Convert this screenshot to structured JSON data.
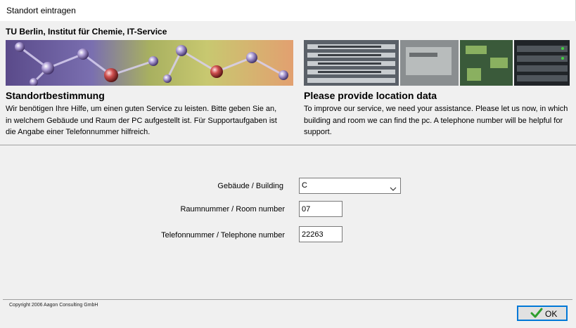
{
  "window": {
    "title": "Standort eintragen"
  },
  "header": {
    "org_title": "TU Berlin, Institut für Chemie, IT-Service",
    "left": {
      "heading": "Standortbestimmung",
      "text": "Wir benötigen Ihre Hilfe, um einen guten Service zu leisten. Bitte geben Sie an, in welchem Gebäude und Raum der PC aufgestellt ist. Für Supportaufgaben ist die Angabe einer Telefonnummer hilfreich."
    },
    "right": {
      "heading": "Please provide location data",
      "text": "To improve our service, we need your assistance. Please let us now, in which building and room we can find the pc. A telephone number will be helpful for support."
    }
  },
  "form": {
    "building": {
      "label": "Gebäude / Building",
      "value": "C"
    },
    "room": {
      "label": "Raumnummer / Room number",
      "value": "07"
    },
    "phone": {
      "label": "Telefonnummer / Telephone number",
      "value": "22263"
    }
  },
  "footer": {
    "copyright": "Copyright 2006 Aagon Consulting GmbH",
    "ok_label": "OK"
  },
  "colors": {
    "focus_border": "#0078d7",
    "ok_check": "#2e9e2e"
  }
}
